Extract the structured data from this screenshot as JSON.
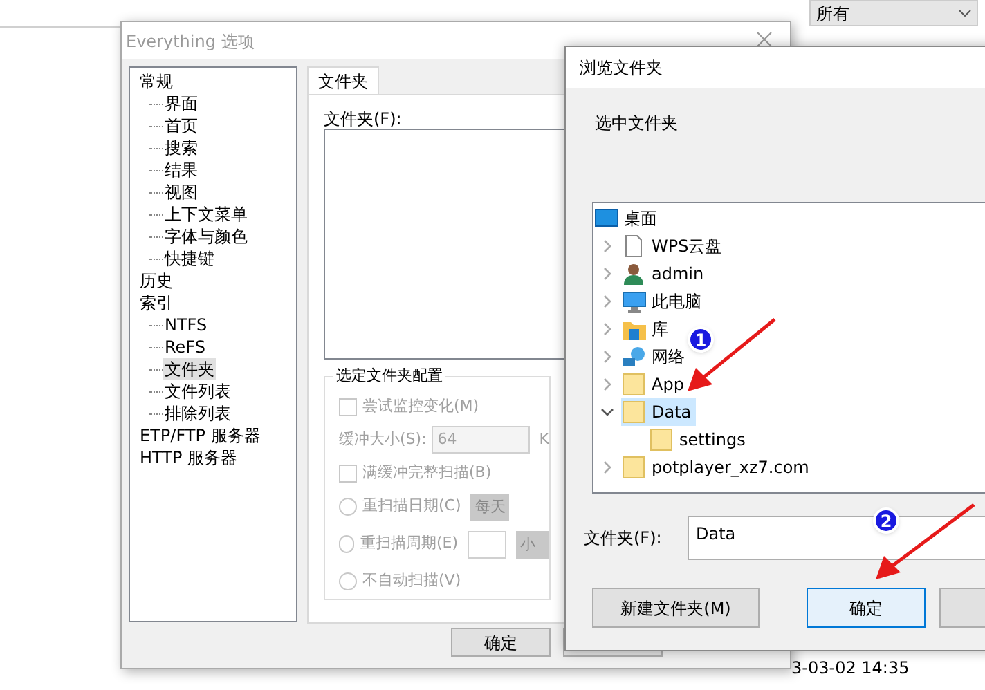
{
  "background_app": {
    "filter_dropdown": "所有",
    "date_fragment": "3-03-02 14:35"
  },
  "options_dialog": {
    "title": "Everything 选项",
    "tree": [
      {
        "label": "常规",
        "selected": false,
        "children": [
          {
            "label": "界面",
            "selected": false
          },
          {
            "label": "首页",
            "selected": false
          },
          {
            "label": "搜索",
            "selected": false
          },
          {
            "label": "结果",
            "selected": false
          },
          {
            "label": "视图",
            "selected": false
          },
          {
            "label": "上下文菜单",
            "selected": false
          },
          {
            "label": "字体与颜色",
            "selected": false
          },
          {
            "label": "快捷键",
            "selected": false
          }
        ]
      },
      {
        "label": "历史",
        "selected": false
      },
      {
        "label": "索引",
        "selected": false,
        "children": [
          {
            "label": "NTFS",
            "selected": false
          },
          {
            "label": "ReFS",
            "selected": false
          },
          {
            "label": "文件夹",
            "selected": true
          },
          {
            "label": "文件列表",
            "selected": false
          },
          {
            "label": "排除列表",
            "selected": false
          }
        ]
      },
      {
        "label": "ETP/FTP 服务器",
        "selected": false
      },
      {
        "label": "HTTP 服务器",
        "selected": false
      }
    ],
    "tab": {
      "label": "文件夹",
      "selected": true
    },
    "folders_label": "文件夹(F):",
    "group": {
      "title": "选定文件夹配置",
      "disabled": true,
      "controls": [
        {
          "kind": "checkbox",
          "label": "尝试监控变化(M)",
          "checked": false
        },
        {
          "kind": "number",
          "label": "缓冲大小(S):",
          "value": "64",
          "unit": "K"
        },
        {
          "kind": "checkbox",
          "label": "满缓冲完整扫描(B)",
          "checked": false
        },
        {
          "kind": "radio",
          "label": "重扫描日期(C)",
          "selected": false,
          "dropdown": "每天"
        },
        {
          "kind": "radio",
          "label": "重扫描周期(E)",
          "selected": false,
          "dropdown": "小"
        },
        {
          "kind": "radio",
          "label": "不自动扫描(V)",
          "selected": false
        }
      ]
    },
    "ok_button": "确定"
  },
  "browse_dialog": {
    "title": "浏览文件夹",
    "prompt": "选中文件夹",
    "tree": [
      {
        "label": "桌面",
        "kind": "desktop",
        "selected": false,
        "children": [
          {
            "label": "WPS云盘",
            "kind": "file",
            "expanded": false,
            "selected": false
          },
          {
            "label": "admin",
            "kind": "user",
            "expanded": false,
            "selected": false
          },
          {
            "label": "此电脑",
            "kind": "computer",
            "expanded": false,
            "selected": false
          },
          {
            "label": "库",
            "kind": "library",
            "expanded": false,
            "selected": false
          },
          {
            "label": "网络",
            "kind": "network",
            "expanded": false,
            "selected": false
          },
          {
            "label": "App",
            "kind": "folder",
            "expanded": false,
            "selected": false
          },
          {
            "label": "Data",
            "kind": "folder",
            "expanded": true,
            "selected": true,
            "children": [
              {
                "label": "settings",
                "kind": "folder",
                "selected": false
              }
            ]
          },
          {
            "label": "potplayer_xz7.com",
            "kind": "folder",
            "expanded": false,
            "selected": false
          }
        ]
      }
    ],
    "folder_label": "文件夹(F):",
    "folder_value": "Data",
    "buttons": [
      {
        "label": "新建文件夹(M)",
        "default": false
      },
      {
        "label": "确定",
        "default": true
      }
    ]
  },
  "annotations": [
    {
      "number": "1"
    },
    {
      "number": "2"
    }
  ]
}
